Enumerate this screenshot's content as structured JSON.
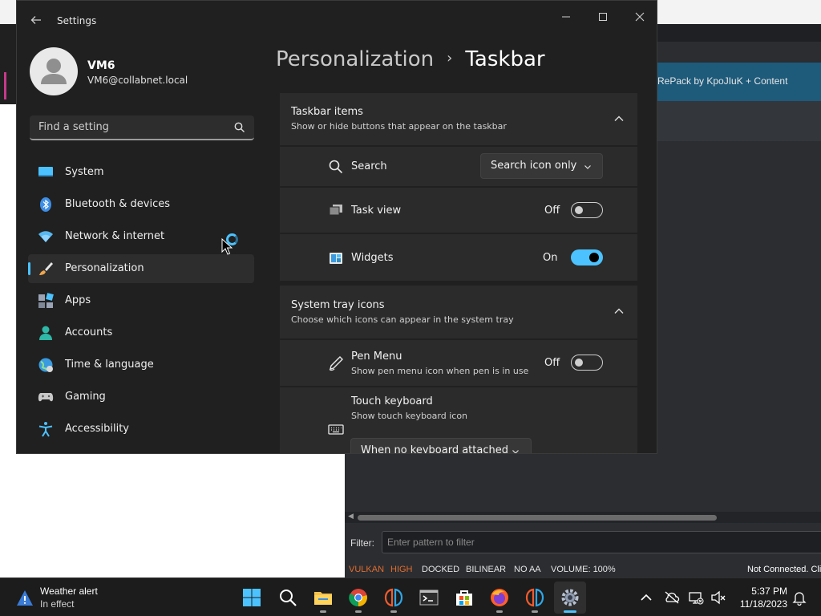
{
  "background_app": {
    "banner_text": "RePack by KpoJIuK + Content",
    "filter_label": "Filter:",
    "filter_placeholder": "Enter pattern to filter",
    "status": [
      {
        "text": "VULKAN",
        "color": "#e06c2d"
      },
      {
        "text": "HIGH",
        "color": "#e06c2d"
      },
      {
        "text": "DOCKED",
        "color": "#e6e6e6"
      },
      {
        "text": "BILINEAR",
        "color": "#e6e6e6"
      },
      {
        "text": "NO AA",
        "color": "#e6e6e6"
      },
      {
        "text": "VOLUME: 100%",
        "color": "#e6e6e6"
      }
    ],
    "connection": "Not Connected. Cli"
  },
  "settings": {
    "window_title": "Settings",
    "user": {
      "name": "VM6",
      "email": "VM6@collabnet.local"
    },
    "search_placeholder": "Find a setting",
    "nav": [
      {
        "label": "System",
        "icon": "system-icon"
      },
      {
        "label": "Bluetooth & devices",
        "icon": "bluetooth-icon"
      },
      {
        "label": "Network & internet",
        "icon": "wifi-icon"
      },
      {
        "label": "Personalization",
        "icon": "brush-icon",
        "selected": true
      },
      {
        "label": "Apps",
        "icon": "apps-icon"
      },
      {
        "label": "Accounts",
        "icon": "accounts-icon"
      },
      {
        "label": "Time & language",
        "icon": "globe-icon"
      },
      {
        "label": "Gaming",
        "icon": "gamepad-icon"
      },
      {
        "label": "Accessibility",
        "icon": "accessibility-icon"
      }
    ],
    "breadcrumb": {
      "parent": "Personalization",
      "separator": "›",
      "current": "Taskbar"
    },
    "taskbar_items": {
      "title": "Taskbar items",
      "subtitle": "Show or hide buttons that appear on the taskbar",
      "search": {
        "label": "Search",
        "value": "Search icon only"
      },
      "task_view": {
        "label": "Task view",
        "state": "Off"
      },
      "widgets": {
        "label": "Widgets",
        "state": "On"
      }
    },
    "system_tray": {
      "title": "System tray icons",
      "subtitle": "Choose which icons can appear in the system tray",
      "pen_menu": {
        "label": "Pen Menu",
        "sub": "Show pen menu icon when pen is in use",
        "state": "Off"
      },
      "touch_keyboard": {
        "label": "Touch keyboard",
        "sub": "Show touch keyboard icon",
        "value": "When no keyboard attached"
      }
    },
    "accent_color": "#4cc2ff"
  },
  "taskbar": {
    "weather": {
      "title": "Weather alert",
      "sub": "In effect"
    },
    "clock": {
      "time": "5:37 PM",
      "date": "11/18/2023"
    },
    "apps": [
      "start-icon",
      "search-icon",
      "file-explorer-icon",
      "chrome-icon",
      "yuzu-icon",
      "terminal-icon",
      "store-icon",
      "firefox-icon",
      "yuzu-icon",
      "settings-icon"
    ]
  }
}
